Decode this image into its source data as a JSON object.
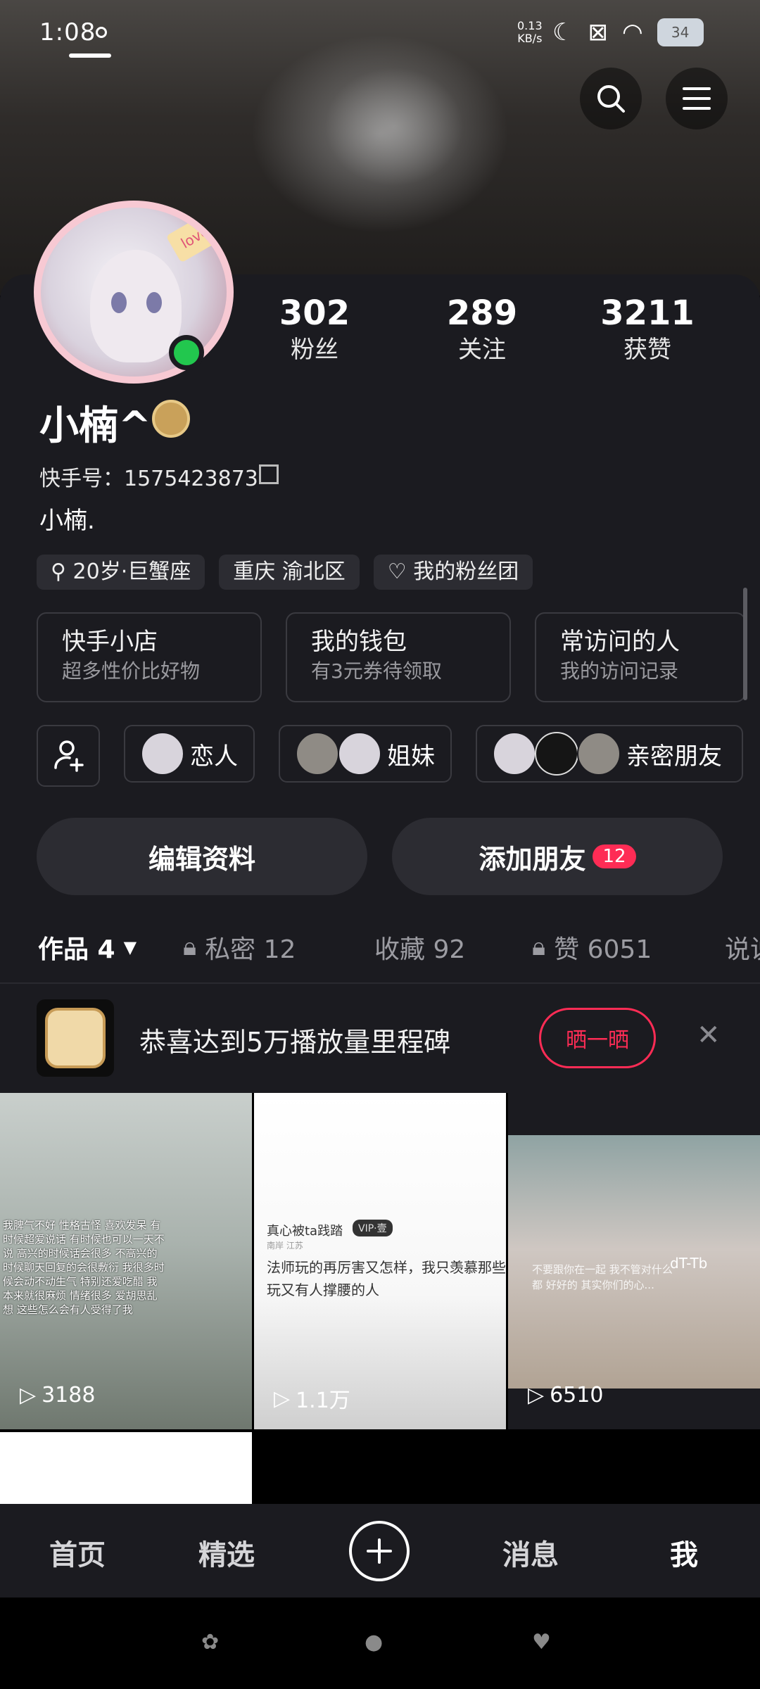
{
  "status_bar": {
    "time": "1:08",
    "net_speed_value": "0.13",
    "net_speed_unit": "KB/s",
    "battery": "34"
  },
  "profile": {
    "stats": [
      {
        "value": "302",
        "label": "粉丝"
      },
      {
        "value": "289",
        "label": "关注"
      },
      {
        "value": "3211",
        "label": "获赞"
      }
    ],
    "username": "小楠^",
    "user_id": "快手号：1575423873",
    "bio": "小楠.",
    "chips": [
      {
        "text": "20岁·巨蟹座",
        "icon": "gender-icon"
      },
      {
        "text": "重庆 渝北区",
        "icon": ""
      },
      {
        "text": "我的粉丝团",
        "icon": "heart-icon"
      }
    ],
    "avatar_tag": "love"
  },
  "cards": [
    {
      "title": "快手小店",
      "sub": "超多性价比好物"
    },
    {
      "title": "我的钱包",
      "sub": "有3元券待领取"
    },
    {
      "title": "常访问的人",
      "sub": "我的访问记录"
    }
  ],
  "friends": [
    {
      "label": "恋人"
    },
    {
      "label": "姐妹"
    },
    {
      "label": "亲密朋友"
    }
  ],
  "actions": {
    "edit": "编辑资料",
    "add_friend": "添加朋友",
    "add_friend_count": "12"
  },
  "tabs": [
    {
      "label": "作品 4",
      "locked": false
    },
    {
      "label": "私密 12",
      "locked": true
    },
    {
      "label": "收藏 92",
      "locked": false
    },
    {
      "label": "赞 6051",
      "locked": true
    },
    {
      "label": "说说",
      "locked": false
    }
  ],
  "milestone": {
    "text": "恭喜达到5万播放量里程碑",
    "button": "晒一晒"
  },
  "videos": [
    {
      "plays": "3188",
      "overlay": "我脾气不好 性格古怪 喜欢发呆 有时候超爱说话 有时候也可以一天不说 高兴的时候话会很多 不高兴的时候聊天回复的会很敷衍 我很多时候会动不动生气 特别还爱吃醋 我本来就很麻烦 情绪很多 爱胡思乱想 这些怎么会有人受得了我"
    },
    {
      "plays": "1.1万",
      "header": "真心被ta践踏",
      "vip": "VIP·壹",
      "location": "南岸 江苏",
      "overlay": "法师玩的再厉害又怎样，我只羡慕那些玩又有人撑腰的人"
    },
    {
      "plays": "6510",
      "watermark": "dT-Tb",
      "overlay": "不要跟你在一起 我不管对什么都 好好的 其实你们的心..."
    }
  ],
  "bottom_nav": {
    "home": "首页",
    "featured": "精选",
    "messages": "消息",
    "me": "我"
  },
  "colors": {
    "accent": "#fe2c55",
    "panel_bg": "#1b1b20",
    "online": "#22c74e"
  }
}
